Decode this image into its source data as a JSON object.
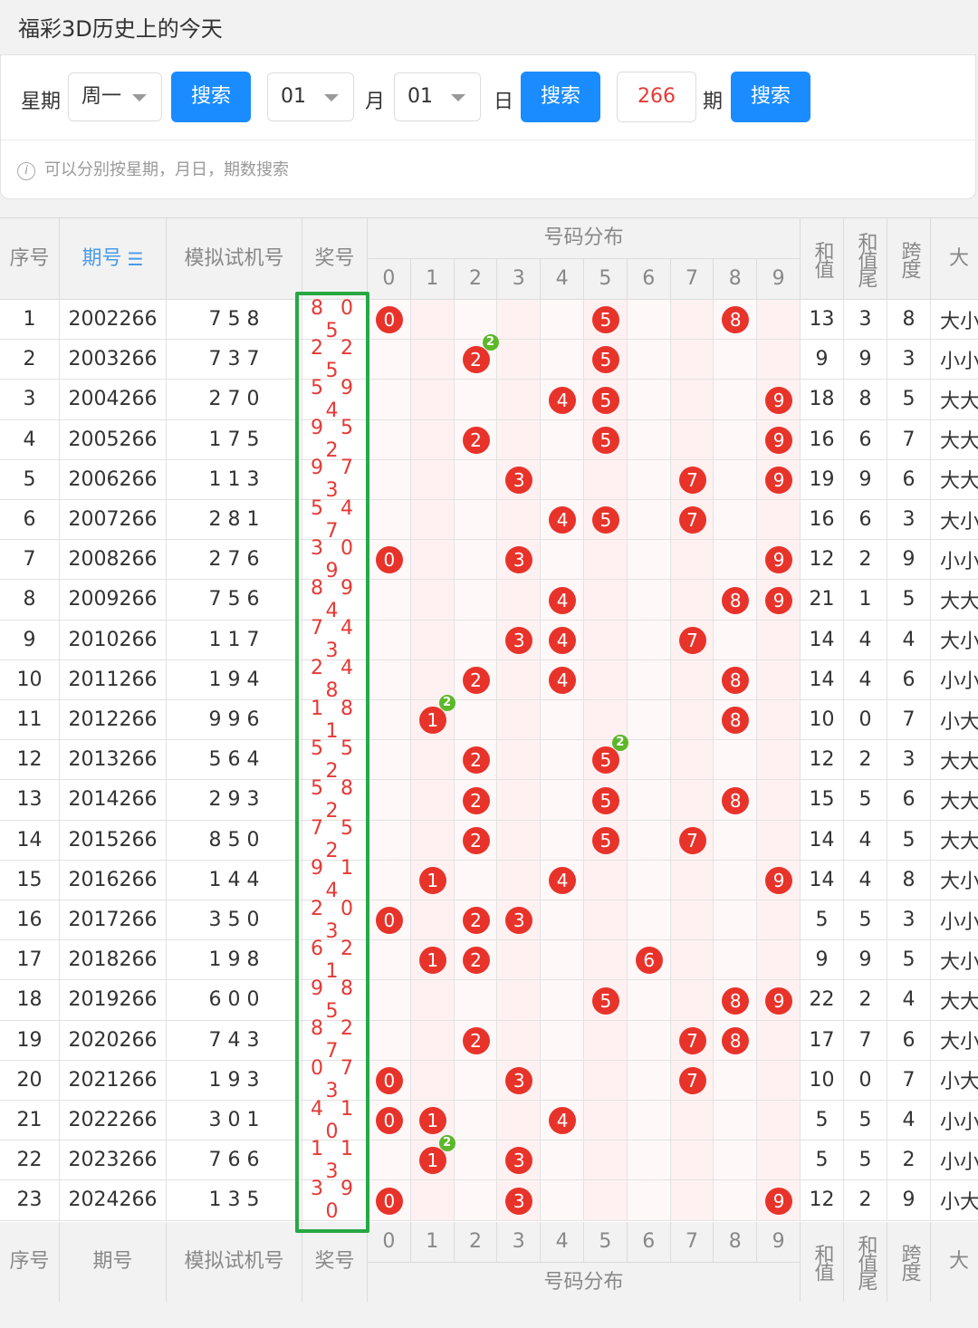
{
  "title": "福彩3D历史上的今天",
  "search": {
    "weekday_label": "星期",
    "weekday_value": "周一",
    "weekday_button": "搜索",
    "month_value": "01",
    "month_label": "月",
    "day_value": "01",
    "day_label": "日",
    "date_button": "搜索",
    "issue_value": "266",
    "issue_label": "期",
    "issue_button": "搜索",
    "hint": "可以分别按星期，月日，期数搜索"
  },
  "table": {
    "headers": {
      "index": "序号",
      "issue": "期号",
      "test_number": "模拟试机号",
      "prize": "奖号",
      "distribution": "号码分布",
      "digits": [
        "0",
        "1",
        "2",
        "3",
        "4",
        "5",
        "6",
        "7",
        "8",
        "9"
      ],
      "sum": "和值",
      "sum_tail": "和值尾",
      "span": "跨度",
      "big_small": "大"
    },
    "rows": [
      {
        "idx": "1",
        "issue": "2002266",
        "test": "7 5 8",
        "win": "8 0 5",
        "sum": "13",
        "tail": "3",
        "span": "8",
        "bs": "大小",
        "balls": [
          0,
          5,
          8
        ],
        "rep": null
      },
      {
        "idx": "2",
        "issue": "2003266",
        "test": "7 3 7",
        "win": "2 2 5",
        "sum": "9",
        "tail": "9",
        "span": "3",
        "bs": "小小",
        "balls": [
          2,
          5
        ],
        "rep": 2
      },
      {
        "idx": "3",
        "issue": "2004266",
        "test": "2 7 0",
        "win": "5 9 4",
        "sum": "18",
        "tail": "8",
        "span": "5",
        "bs": "大大",
        "balls": [
          4,
          5,
          9
        ],
        "rep": null
      },
      {
        "idx": "4",
        "issue": "2005266",
        "test": "1 7 5",
        "win": "9 5 2",
        "sum": "16",
        "tail": "6",
        "span": "7",
        "bs": "大大",
        "balls": [
          2,
          5,
          9
        ],
        "rep": null
      },
      {
        "idx": "5",
        "issue": "2006266",
        "test": "1 1 3",
        "win": "9 7 3",
        "sum": "19",
        "tail": "9",
        "span": "6",
        "bs": "大大",
        "balls": [
          3,
          7,
          9
        ],
        "rep": null
      },
      {
        "idx": "6",
        "issue": "2007266",
        "test": "2 8 1",
        "win": "5 4 7",
        "sum": "16",
        "tail": "6",
        "span": "3",
        "bs": "大小",
        "balls": [
          4,
          5,
          7
        ],
        "rep": null
      },
      {
        "idx": "7",
        "issue": "2008266",
        "test": "2 7 6",
        "win": "3 0 9",
        "sum": "12",
        "tail": "2",
        "span": "9",
        "bs": "小小",
        "balls": [
          0,
          3,
          9
        ],
        "rep": null
      },
      {
        "idx": "8",
        "issue": "2009266",
        "test": "7 5 6",
        "win": "8 9 4",
        "sum": "21",
        "tail": "1",
        "span": "5",
        "bs": "大大",
        "balls": [
          4,
          8,
          9
        ],
        "rep": null
      },
      {
        "idx": "9",
        "issue": "2010266",
        "test": "1 1 7",
        "win": "7 4 3",
        "sum": "14",
        "tail": "4",
        "span": "4",
        "bs": "大小",
        "balls": [
          3,
          4,
          7
        ],
        "rep": null
      },
      {
        "idx": "10",
        "issue": "2011266",
        "test": "1 9 4",
        "win": "2 4 8",
        "sum": "14",
        "tail": "4",
        "span": "6",
        "bs": "小小",
        "balls": [
          2,
          4,
          8
        ],
        "rep": null
      },
      {
        "idx": "11",
        "issue": "2012266",
        "test": "9 9 6",
        "win": "1 8 1",
        "sum": "10",
        "tail": "0",
        "span": "7",
        "bs": "小大",
        "balls": [
          1,
          8
        ],
        "rep": 1
      },
      {
        "idx": "12",
        "issue": "2013266",
        "test": "5 6 4",
        "win": "5 5 2",
        "sum": "12",
        "tail": "2",
        "span": "3",
        "bs": "大大",
        "balls": [
          2,
          5
        ],
        "rep": 5
      },
      {
        "idx": "13",
        "issue": "2014266",
        "test": "2 9 3",
        "win": "5 8 2",
        "sum": "15",
        "tail": "5",
        "span": "6",
        "bs": "大大",
        "balls": [
          2,
          5,
          8
        ],
        "rep": null
      },
      {
        "idx": "14",
        "issue": "2015266",
        "test": "8 5 0",
        "win": "7 5 2",
        "sum": "14",
        "tail": "4",
        "span": "5",
        "bs": "大大",
        "balls": [
          2,
          5,
          7
        ],
        "rep": null
      },
      {
        "idx": "15",
        "issue": "2016266",
        "test": "1 4 4",
        "win": "9 1 4",
        "sum": "14",
        "tail": "4",
        "span": "8",
        "bs": "大小",
        "balls": [
          1,
          4,
          9
        ],
        "rep": null
      },
      {
        "idx": "16",
        "issue": "2017266",
        "test": "3 5 0",
        "win": "2 0 3",
        "sum": "5",
        "tail": "5",
        "span": "3",
        "bs": "小小",
        "balls": [
          0,
          2,
          3
        ],
        "rep": null
      },
      {
        "idx": "17",
        "issue": "2018266",
        "test": "1 9 8",
        "win": "6 2 1",
        "sum": "9",
        "tail": "9",
        "span": "5",
        "bs": "大小",
        "balls": [
          1,
          2,
          6
        ],
        "rep": null
      },
      {
        "idx": "18",
        "issue": "2019266",
        "test": "6 0 0",
        "win": "9 8 5",
        "sum": "22",
        "tail": "2",
        "span": "4",
        "bs": "大大",
        "balls": [
          5,
          8,
          9
        ],
        "rep": null
      },
      {
        "idx": "19",
        "issue": "2020266",
        "test": "7 4 3",
        "win": "8 2 7",
        "sum": "17",
        "tail": "7",
        "span": "6",
        "bs": "大小",
        "balls": [
          2,
          7,
          8
        ],
        "rep": null
      },
      {
        "idx": "20",
        "issue": "2021266",
        "test": "1 9 3",
        "win": "0 7 3",
        "sum": "10",
        "tail": "0",
        "span": "7",
        "bs": "小大",
        "balls": [
          0,
          3,
          7
        ],
        "rep": null
      },
      {
        "idx": "21",
        "issue": "2022266",
        "test": "3 0 1",
        "win": "4 1 0",
        "sum": "5",
        "tail": "5",
        "span": "4",
        "bs": "小小",
        "balls": [
          0,
          1,
          4
        ],
        "rep": null
      },
      {
        "idx": "22",
        "issue": "2023266",
        "test": "7 6 6",
        "win": "1 1 3",
        "sum": "5",
        "tail": "5",
        "span": "2",
        "bs": "小小",
        "balls": [
          1,
          3
        ],
        "rep": 1
      },
      {
        "idx": "23",
        "issue": "2024266",
        "test": "1 3 5",
        "win": "3 9 0",
        "sum": "12",
        "tail": "2",
        "span": "9",
        "bs": "小大",
        "balls": [
          0,
          3,
          9
        ],
        "rep": null
      }
    ]
  }
}
